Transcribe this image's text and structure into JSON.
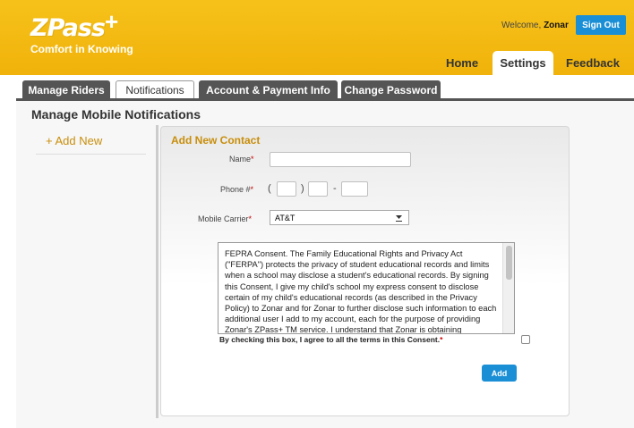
{
  "header": {
    "logo_text": "ZPass",
    "logo_plus": "+",
    "tagline": "Comfort in Knowing",
    "welcome_prefix": "Welcome, ",
    "welcome_user": "Zonar",
    "signout_label": "Sign Out",
    "nav": {
      "home": "Home",
      "settings": "Settings",
      "feedback": "Feedback"
    }
  },
  "subtabs": {
    "manage_riders": "Manage Riders",
    "notifications": "Notifications",
    "account_payment": "Account & Payment Info",
    "change_password": "Change Password"
  },
  "page_title": "Manage Mobile Notifications",
  "sidebar": {
    "add_new": "+ Add New"
  },
  "form": {
    "title": "Add New Contact",
    "name_label": "Name",
    "name_value": "",
    "phone_label": "Phone #",
    "phone_open": "(",
    "phone_close": ")",
    "phone_dash": "-",
    "phone_area": "",
    "phone_prefix": "",
    "phone_line": "",
    "carrier_label": "Mobile Carrier",
    "carrier_selected": "AT&T",
    "required_mark": "*",
    "consent_text": "FEPRA Consent. The Family Educational Rights and Privacy Act (\"FERPA\") protects the privacy of student educational records and limits when a school may disclose a student's educational records. By signing this Consent, I give my child's school my express consent to disclose certain of my child's educational records (as described in the Privacy Policy) to Zonar and for Zonar to further disclose such information to each additional user I add to my account, each for the purpose of providing Zonar's ZPass+ TM service. I understand that Zonar is obtaining",
    "agree_text": "By checking this box, I agree to all the terms in this Consent.",
    "agree_checked": false,
    "add_button": "Add"
  },
  "colors": {
    "header_yellow": "#f0b20b",
    "accent_gold": "#c88e0b",
    "button_blue": "#1a8fd6",
    "required_red": "#cc0000"
  }
}
